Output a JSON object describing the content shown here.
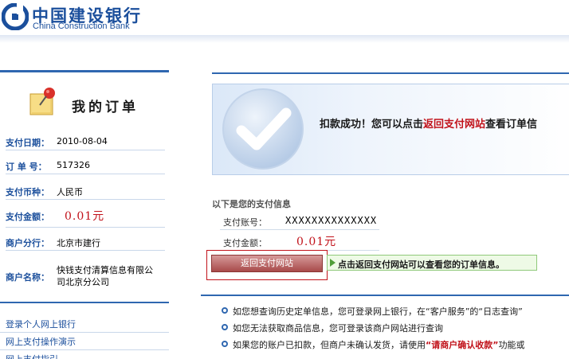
{
  "brand": {
    "name_cn": "中国建设银行",
    "name_en": "China Construction Bank",
    "color": "#1b4f9c"
  },
  "sidebar": {
    "title": "我的订单",
    "icon": "pushpin-note-icon",
    "details": [
      {
        "label": "支付日期：",
        "value": "2010-08-04"
      },
      {
        "label": "订 单 号：",
        "value": "517326"
      },
      {
        "label": "支付币种：",
        "value": "人民币"
      },
      {
        "label": "支付金额：",
        "value": "0.01元"
      },
      {
        "label": "商户分行：",
        "value": "北京市建行"
      },
      {
        "label": "商户名称：",
        "value": "快钱支付清算信息有限公司北京分公司"
      }
    ],
    "links": [
      "登录个人网上银行",
      "网上支付操作演示",
      "网上支付指引"
    ]
  },
  "result": {
    "icon": "check-circle-icon",
    "text_before": "扣款成功！您可以点击",
    "link": "返回支付网站",
    "text_after": "查看订单信"
  },
  "payment_info": {
    "header": "以下是您的支付信息",
    "account_label": "支付账号：",
    "account_value": "XXXXXXXXXXXXXX",
    "amount_label": "支付金额：",
    "amount_value": "0.01元"
  },
  "actions": {
    "return_button": "返回支付网站",
    "hint": "点击返回支付网站可以查看您的订单信息。"
  },
  "tips": [
    {
      "before": "如您想查询历史定单信息，您可登录网上银行，在“客户服务”的“日志查询”",
      "highlight": "",
      "after": ""
    },
    {
      "before": "如您无法获取商品信息，您可登录该商户网站进行查询",
      "highlight": "",
      "after": ""
    },
    {
      "before": "如果您的账户已扣款，但商户未确认发货，请使用",
      "highlight": "“请商户确认收款”",
      "after": "功能或"
    }
  ],
  "colors": {
    "accent_blue": "#2f67b0",
    "alert_red": "#c1121a",
    "hint_green": "#4f9e38"
  }
}
